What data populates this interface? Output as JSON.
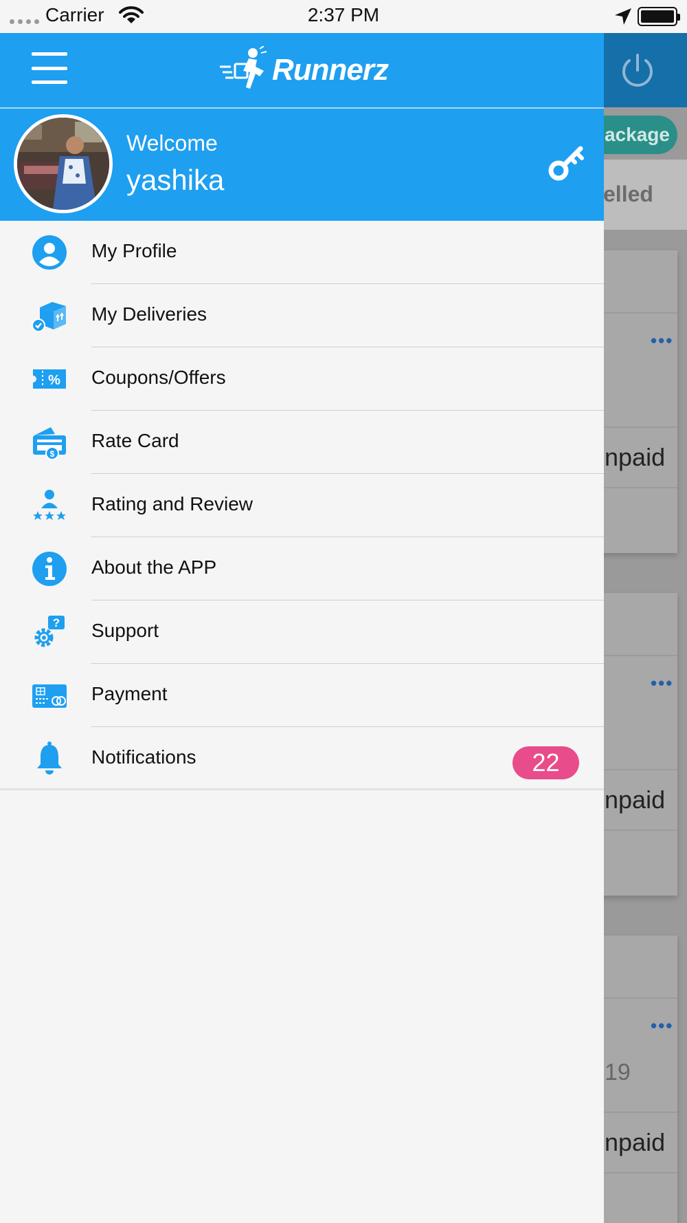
{
  "status_bar": {
    "carrier": "Carrier",
    "time": "2:37 PM"
  },
  "background": {
    "package_pill": "ackage",
    "filter_text": "elled",
    "cards": [
      {
        "status": "npaid"
      },
      {
        "status": "npaid"
      },
      {
        "date_fragment": "19",
        "status": "npaid"
      }
    ]
  },
  "drawer": {
    "brand": "Runnerz",
    "welcome": "Welcome",
    "username": "yashika",
    "items": [
      {
        "label": "My Profile",
        "icon": "user-icon"
      },
      {
        "label": "My Deliveries",
        "icon": "delivery-box-icon"
      },
      {
        "label": "Coupons/Offers",
        "icon": "coupon-icon"
      },
      {
        "label": "Rate Card",
        "icon": "rate-card-icon"
      },
      {
        "label": "Rating and Review",
        "icon": "rating-icon"
      },
      {
        "label": "About the APP",
        "icon": "info-icon"
      },
      {
        "label": "Support",
        "icon": "support-gear-icon"
      },
      {
        "label": "Payment",
        "icon": "payment-card-icon"
      },
      {
        "label": "Notifications",
        "icon": "bell-icon",
        "badge": "22"
      }
    ]
  },
  "colors": {
    "primary": "#1e9ff0",
    "badge": "#e94c8a",
    "pill": "#2a8f88"
  }
}
